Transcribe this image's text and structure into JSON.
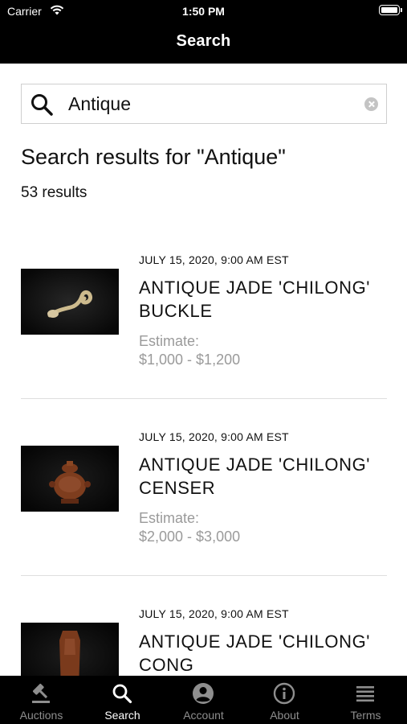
{
  "status_bar": {
    "carrier": "Carrier",
    "time": "1:50 PM"
  },
  "nav": {
    "title": "Search"
  },
  "search": {
    "value": "Antique",
    "placeholder": ""
  },
  "results": {
    "heading": "Search results for \"Antique\"",
    "count": "53 results",
    "items": [
      {
        "date": "JULY 15, 2020, 9:00 AM EST",
        "title": "ANTIQUE JADE 'CHILONG' BUCKLE",
        "estimate_label": "Estimate:",
        "estimate_range": "$1,000 - $1,200"
      },
      {
        "date": "JULY 15, 2020, 9:00 AM EST",
        "title": "ANTIQUE JADE 'CHILONG' CENSER",
        "estimate_label": "Estimate:",
        "estimate_range": "$2,000 - $3,000"
      },
      {
        "date": "JULY 15, 2020, 9:00 AM EST",
        "title": "ANTIQUE JADE 'CHILONG' CONG",
        "estimate_label": "",
        "estimate_range": ""
      }
    ]
  },
  "tabs": [
    {
      "label": "Auctions",
      "icon": "gavel-icon",
      "active": false
    },
    {
      "label": "Search",
      "icon": "search-icon",
      "active": true
    },
    {
      "label": "Account",
      "icon": "account-icon",
      "active": false
    },
    {
      "label": "About",
      "icon": "info-icon",
      "active": false
    },
    {
      "label": "Terms",
      "icon": "list-icon",
      "active": false
    }
  ],
  "colors": {
    "bar_background": "#000000",
    "tab_active": "#ffffff",
    "tab_inactive": "#8e8e8e",
    "estimate_text": "#9a9a9a"
  }
}
